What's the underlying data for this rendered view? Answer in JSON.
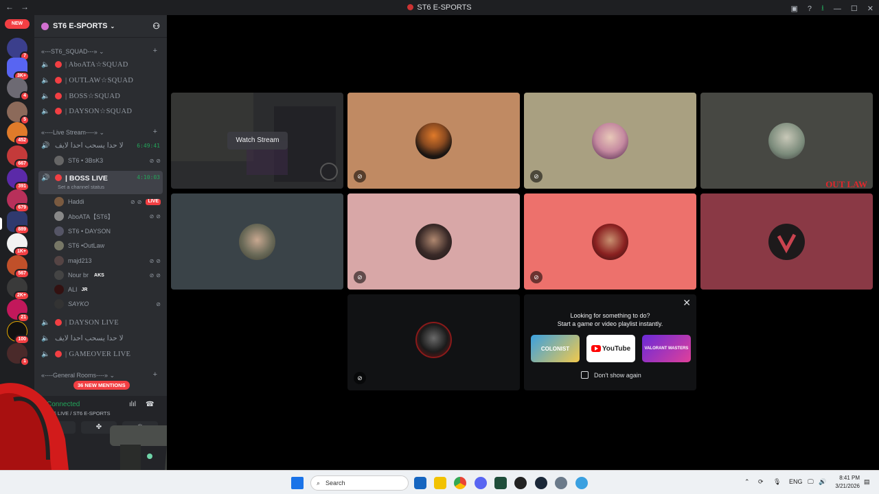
{
  "window": {
    "title": "ST6 E-SPORTS",
    "back": "←",
    "forward": "→"
  },
  "guilds": {
    "new_label": "NEW",
    "badges": [
      "7",
      "3K+",
      "4",
      "5",
      "452",
      "667",
      "391",
      "679",
      "889",
      "1K+",
      "567",
      "2K+",
      "21",
      "100",
      "1"
    ]
  },
  "sidebar": {
    "server_name": "ST6 E-SPORTS",
    "categories": [
      {
        "label": "«---ST6_SQUAD---»",
        "channels": [
          "| AboATA☆SQUAD",
          "| OUTLAW☆SQUAD",
          "| BOSS☆SQUAD",
          "| DAYSON☆SQUAD"
        ]
      },
      {
        "label": "«----Live Stream----»"
      },
      {
        "label": "«----General Rooms----»"
      }
    ],
    "live_channel_1": {
      "name": "لا حدا يسحب احدا لايف",
      "timer": "6:49:41"
    },
    "live_member_1": "ST6 • 3BsK3",
    "boss_live": {
      "name": "| BOSS LIVE",
      "timer": "4:10:03",
      "status": "Set a channel status"
    },
    "members": [
      "Haddi",
      "AboATA【ST6】",
      "ST6 • DAYSON",
      "ST6 •OutLaw",
      "majd213",
      "Nour br",
      "ALI",
      "SAYKO"
    ],
    "member_tags": {
      "live": "LIVE",
      "aks": "AKS",
      "jr": "JR"
    },
    "dayson_live": "| DAYSON LIVE",
    "dayson_sub": "لا حدا يسحب احدا لايف",
    "gameover_live": "| GAMEOVER LIVE",
    "mentions": "36 NEW MENTIONS"
  },
  "voice": {
    "connected": "Connected",
    "location": "BOSS LIVE / ST6 E-SPORTS"
  },
  "stage": {
    "watch_stream": "Watch Stream",
    "outlaw_logo": "OUT LAW",
    "tiles": [
      {
        "color": "#2e2e30"
      },
      {
        "color": "#c08a63"
      },
      {
        "color": "#a9a081"
      },
      {
        "color": "#474843"
      },
      {
        "color": "#3a4348"
      },
      {
        "color": "#d8a7a7"
      },
      {
        "color": "#ed716c"
      },
      {
        "color": "#8a3945"
      },
      {
        "color": "#111214"
      }
    ]
  },
  "promo": {
    "line1": "Looking for something to do?",
    "line2": "Start a game or video playlist instantly.",
    "apps": [
      "COLONIST",
      "YouTube",
      "VALORANT MASTERS"
    ],
    "dont_show": "Don't show again"
  },
  "taskbar": {
    "search": "Search",
    "lang": "ENG",
    "time": "8:41 PM",
    "date": "3/21/2026"
  }
}
